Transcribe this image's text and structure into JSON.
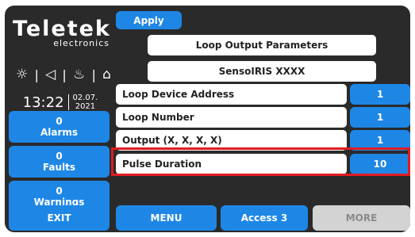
{
  "brand": {
    "name": "Teletek",
    "sub": "electronics"
  },
  "status_icons": [
    "sun-icon",
    "speaker-icon",
    "fire-icon",
    "door-icon"
  ],
  "clock": {
    "time": "13:22",
    "date_day": "02.07.",
    "date_year": "2021"
  },
  "sidebar": {
    "alarms": {
      "count": "0",
      "label": "Alarms"
    },
    "faults": {
      "count": "0",
      "label": "Faults"
    },
    "warnings": {
      "count": "0",
      "label": "Warnings"
    }
  },
  "header": {
    "apply_label": "Apply",
    "title": "Loop Output Parameters",
    "device": "SensoIRIS XXXX"
  },
  "params": [
    {
      "label": "Loop Device Address",
      "value": "1"
    },
    {
      "label": "Loop Number",
      "value": "1"
    },
    {
      "label": "Output (X, X, X, X)",
      "value": "1"
    },
    {
      "label": "Pulse Duration",
      "value": "10"
    }
  ],
  "footer": {
    "exit": "EXIT",
    "menu": "MENU",
    "access": "Access 3",
    "more": "MORE"
  }
}
